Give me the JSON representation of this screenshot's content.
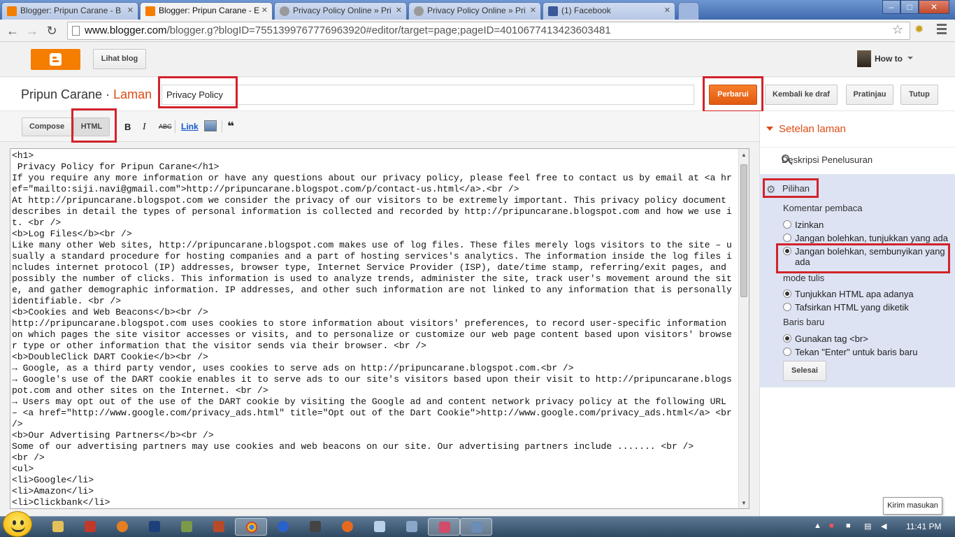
{
  "browser": {
    "tabs": [
      {
        "title": "Blogger: Pripun Carane - B",
        "favicon_color": "#f57d00",
        "active": false
      },
      {
        "title": "Blogger: Pripun Carane - E",
        "favicon_color": "#f57d00",
        "active": true
      },
      {
        "title": "Privacy Policy Online » Pri",
        "favicon_color": "#777777",
        "active": false
      },
      {
        "title": "Privacy Policy Online » Pri",
        "favicon_color": "#777777",
        "active": false
      },
      {
        "title": "(1) Facebook",
        "favicon_color": "#3b5998",
        "active": false
      }
    ],
    "url_host": "www.blogger.com",
    "url_path": "/blogger.g?blogID=7551399767776963920#editor/target=page;pageID=4010677413423603481",
    "window_controls": [
      "–",
      "□",
      "✕"
    ]
  },
  "header": {
    "view_blog": "Lihat blog",
    "user_name": "How to"
  },
  "editor": {
    "blog_name": "Pripun Carane",
    "separator": " · ",
    "section": "Laman",
    "page_title_value": "Privacy Policy",
    "buttons": {
      "update": "Perbarui",
      "revert": "Kembali ke draf",
      "preview": "Pratinjau",
      "close": "Tutup"
    },
    "modes": {
      "compose": "Compose",
      "html": "HTML"
    },
    "format": {
      "bold": "B",
      "italic": "I",
      "strike": "ABC",
      "link": "Link",
      "quote": "❝"
    },
    "code": "<h1>\n Privacy Policy for Pripun Carane</h1>\nIf you require any more information or have any questions about our privacy policy, please feel free to contact us by email at <a href=\"mailto:siji.navi@gmail.com\">http://pripuncarane.blogspot.com/p/contact-us.html</a>.<br />\nAt http://pripuncarane.blogspot.com we consider the privacy of our visitors to be extremely important. This privacy policy document describes in detail the types of personal information is collected and recorded by http://pripuncarane.blogspot.com and how we use it. <br />\n<b>Log Files</b><br />\nLike many other Web sites, http://pripuncarane.blogspot.com makes use of log files. These files merely logs visitors to the site – usually a standard procedure for hosting companies and a part of hosting services's analytics. The information inside the log files includes internet protocol (IP) addresses, browser type, Internet Service Provider (ISP), date/time stamp, referring/exit pages, and possibly the number of clicks. This information is used to analyze trends, administer the site, track user's movement around the site, and gather demographic information. IP addresses, and other such information are not linked to any information that is personally identifiable. <br />\n<b>Cookies and Web Beacons</b><br />\nhttp://pripuncarane.blogspot.com uses cookies to store information about visitors' preferences, to record user-specific information on which pages the site visitor accesses or visits, and to personalize or customize our web page content based upon visitors' browser type or other information that the visitor sends via their browser. <br />\n<b>DoubleClick DART Cookie</b><br />\n→ Google, as a third party vendor, uses cookies to serve ads on http://pripuncarane.blogspot.com.<br />\n→ Google's use of the DART cookie enables it to serve ads to our site's visitors based upon their visit to http://pripuncarane.blogspot.com and other sites on the Internet. <br />\n→ Users may opt out of the use of the DART cookie by visiting the Google ad and content network privacy policy at the following URL – <a href=\"http://www.google.com/privacy_ads.html\" title=\"Opt out of the Dart Cookie\">http://www.google.com/privacy_ads.html</a> <br />\n<b>Our Advertising Partners</b><br />\nSome of our advertising partners may use cookies and web beacons on our site. Our advertising partners include ....... <br />\n<br />\n<ul>\n<li>Google</li>\n<li>Amazon</li>\n<li>Clickbank</li>"
  },
  "sidebar": {
    "title": "Setelan laman",
    "search_description": "Deskripsi Penelusuran",
    "options_title": "Pilihan",
    "reader_comments": {
      "label": "Komentar pembaca",
      "options": [
        "Izinkan",
        "Jangan bolehkan, tunjukkan yang ada",
        "Jangan bolehkan, sembunyikan yang ada"
      ],
      "selected": 2
    },
    "compose_mode": {
      "label": "mode tulis",
      "options": [
        "Tunjukkan HTML apa adanya",
        "Tafsirkan HTML yang diketik"
      ],
      "selected": 0
    },
    "line_breaks": {
      "label": "Baris baru",
      "options": [
        "Gunakan tag <br>",
        "Tekan \"Enter\" untuk baris baru"
      ],
      "selected": 0
    },
    "done": "Selesai"
  },
  "feedback": "Kirim masukan",
  "taskbar": {
    "clock": "11:41 PM"
  },
  "colors": {
    "accent": "#dd4b13",
    "blogger_orange": "#f57d00",
    "highlight": "#d2232a",
    "options_bg": "#dde3f3"
  }
}
